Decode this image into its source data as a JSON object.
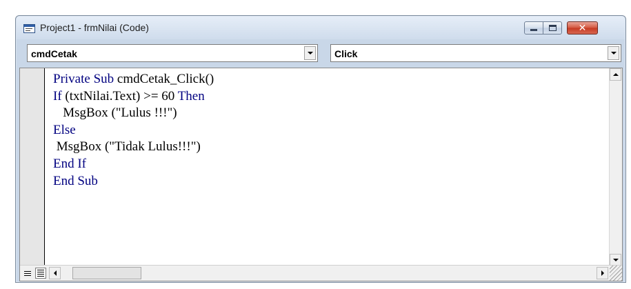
{
  "window": {
    "title": "Project1 - frmNilai (Code)",
    "icon": "vb-code-window-icon",
    "buttons": {
      "minimize": "minimize-icon",
      "maximize": "maximize-icon",
      "close": "✕"
    }
  },
  "object_combo": {
    "value": "cmdCetak"
  },
  "procedure_combo": {
    "value": "Click"
  },
  "code": {
    "lines": [
      [
        {
          "t": "Private Sub ",
          "k": true
        },
        {
          "t": "cmdCetak_Click()",
          "k": false
        }
      ],
      [
        {
          "t": "If ",
          "k": true
        },
        {
          "t": "(txtNilai.Text) >= 60 ",
          "k": false
        },
        {
          "t": "Then",
          "k": true
        }
      ],
      [
        {
          "t": "   MsgBox (\"Lulus !!!\")",
          "k": false
        }
      ],
      [
        {
          "t": "Else",
          "k": true
        }
      ],
      [
        {
          "t": " MsgBox (\"Tidak Lulus!!!\")",
          "k": false
        }
      ],
      [
        {
          "t": "End If",
          "k": true
        }
      ],
      [
        {
          "t": "End Sub",
          "k": true
        }
      ]
    ]
  },
  "colors": {
    "keyword": "#000080",
    "text": "#000000",
    "close_button": "#c63a22"
  }
}
